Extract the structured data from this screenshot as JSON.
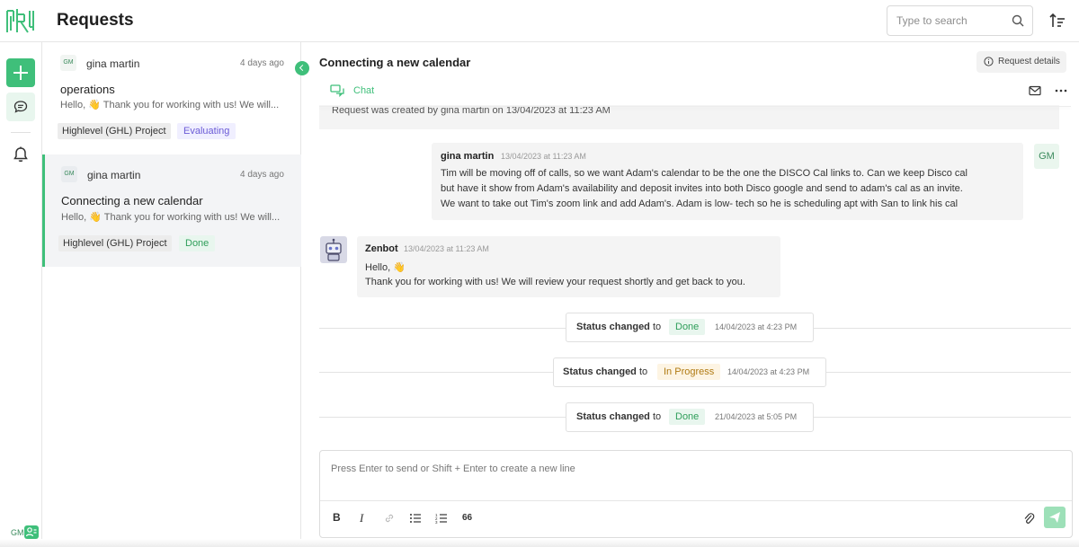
{
  "header": {
    "title": "Requests",
    "search_placeholder": "Type to search"
  },
  "rail": {
    "user_initials": "GM"
  },
  "requests": [
    {
      "avatar": "GM",
      "author": "gina martin",
      "time": "4 days ago",
      "title": "operations",
      "preview": "Hello, 👋 Thank you for working with us! We will...",
      "project": "Highlevel (GHL) Project",
      "status": "Evaluating"
    },
    {
      "avatar": "GM",
      "author": "gina martin",
      "time": "4 days ago",
      "title": "Connecting a new calendar",
      "preview": "Hello, 👋 Thank you for working with us! We will...",
      "project": "Highlevel (GHL) Project",
      "status": "Done"
    }
  ],
  "conversation": {
    "title": "Connecting a new calendar",
    "details_label": "Request details",
    "tab_chat": "Chat",
    "created_note": "Request was created by gina martin on 13/04/2023 at 11:23 AM",
    "user_message": {
      "author": "gina martin",
      "time": "13/04/2023 at 11:23 AM",
      "avatar": "GM",
      "lines": [
        "Tim will be moving off of calls, so we want Adam's calendar to be the one the DISCO Cal links to. Can we keep Disco cal",
        "but have it show from Adam's availability and deposit invites into both Disco google and send to adam's cal as an invite.",
        "We want to take out Tim's zoom link and add Adam's. Adam is low- tech so he is scheduling apt with San to link his cal"
      ]
    },
    "bot_message": {
      "author": "Zenbot",
      "time": "13/04/2023 at 11:23 AM",
      "lines": [
        "Hello, 👋",
        "Thank you for working with us! We will review your request shortly and get back to you."
      ]
    },
    "status_changes": [
      {
        "label": "Status changed",
        "to": "to",
        "value": "Done",
        "time": "14/04/2023 at 4:23 PM"
      },
      {
        "label": "Status changed",
        "to": "to",
        "value": "In Progress",
        "time": "14/04/2023 at 4:23 PM"
      },
      {
        "label": "Status changed",
        "to": "to",
        "value": "Done",
        "time": "21/04/2023 at 5:05 PM"
      }
    ]
  },
  "composer": {
    "placeholder": "Press Enter to send or Shift + Enter to create a new line",
    "toolbar": {
      "bold": "B",
      "italic": "I",
      "quote": "66"
    }
  },
  "colors": {
    "accent": "#3fbf7a",
    "evaluating": "#6b5bd6",
    "in_progress": "#b07a12"
  }
}
